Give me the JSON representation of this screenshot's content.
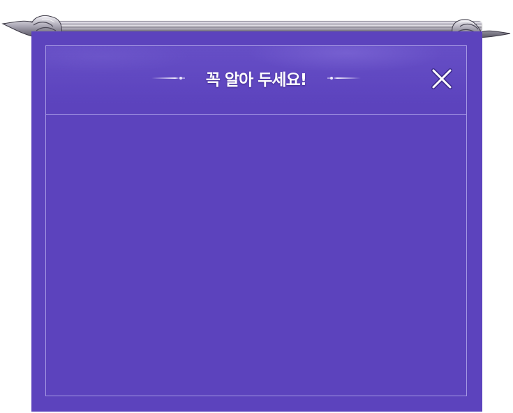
{
  "dialog": {
    "title": "꼭 알아 두세요!",
    "close_icon": "close-icon",
    "body_text": ""
  },
  "decor": {
    "rod": "metal-rod",
    "left_ornament": "winged-ornament-left",
    "right_ornament": "winged-ornament-right",
    "title_left_icon": "dagger-flourish-left-icon",
    "title_right_icon": "dagger-flourish-right-icon"
  },
  "colors": {
    "panel": "#5c43bd",
    "frame_line": "#beb4f0",
    "title_text": "#ffffff"
  }
}
